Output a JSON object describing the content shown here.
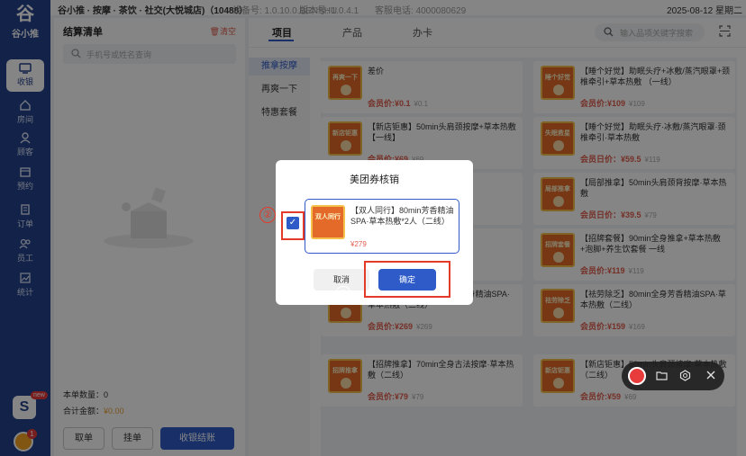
{
  "sidebar": {
    "logo_text": "谷小推",
    "items": [
      {
        "label": "收银",
        "icon": "cashier-icon",
        "active": true
      },
      {
        "label": "房间",
        "icon": "home-icon"
      },
      {
        "label": "顾客",
        "icon": "customer-icon"
      },
      {
        "label": "预约",
        "icon": "calendar-icon"
      },
      {
        "label": "订单",
        "icon": "order-icon"
      },
      {
        "label": "员工",
        "icon": "staff-icon"
      },
      {
        "label": "统计",
        "icon": "chart-icon"
      }
    ],
    "badge_new": "new",
    "badge_count": "1"
  },
  "topbar": {
    "store": "谷小推 · 按摩 · 茶饮 · 社交(大悦城店)（10488）",
    "device": "设备号: 1.0.10.0.BENSHU",
    "version": "版本号: 1.0.4.1",
    "phone": "客服电话: 4000080629",
    "date": "2025-08-12 星期二"
  },
  "left": {
    "title": "结算清单",
    "clear": "清空",
    "search_placeholder": "手机号或姓名查询",
    "count": "本单数量：0",
    "total_label": "合计金额：",
    "total_value": "¥0.00",
    "btn_cancel_order": "取单",
    "btn_hold": "挂单",
    "btn_checkout": "收银结账"
  },
  "right": {
    "tabs": [
      "项目",
      "产品",
      "办卡"
    ],
    "search_placeholder": "输入品项关键字搜索",
    "categories": [
      "推拿按摩",
      "再爽一下",
      "特惠套餐"
    ],
    "cards": [
      {
        "thumb": "再爽一下",
        "name": "差价",
        "price": "会员价:¥0.1",
        "orig": "¥0.1"
      },
      {
        "thumb": "睡个好觉",
        "name": "【睡个好觉】助眠头疗+冰敷/蒸汽眼罩+颈椎牵引+草本热敷 （一线）",
        "price": "会员价:¥109",
        "orig": "¥109"
      },
      {
        "thumb": "新店钜惠",
        "name": "【新店钜惠】50min头肩颈按摩+草本热敷【一线】",
        "price": "会员价:¥69",
        "orig": "¥69"
      },
      {
        "thumb": "失眠救星",
        "name": "【睡个好觉】助眠头疗·冰敷/蒸汽眼罩·颈椎牵引·草本热敷",
        "price": "会员日价：¥59.5",
        "orig": "¥119"
      },
      {
        "thumb": "双人同行",
        "name": "按摩·草本热",
        "price": "",
        "orig": ""
      },
      {
        "thumb": "局部推拿",
        "name": "【局部推拿】50min头肩颈背按摩·草本热敷",
        "price": "会员日价：¥39.5",
        "orig": "¥79"
      },
      {
        "thumb": "双人同行",
        "name": "蒸汽眼罩·颈",
        "price": "",
        "orig": ""
      },
      {
        "thumb": "招牌套餐",
        "name": "【招牌套餐】90min全身推拿+草本热敷+泡脚+养生饮套餐 一线",
        "price": "会员价:¥119",
        "orig": "¥119"
      },
      {
        "thumb": "舒缓放松",
        "name": "【舒缓放松】100min芳香全身精油SPA·草本热敷（二线）",
        "price": "会员价:¥269",
        "orig": "¥269"
      },
      {
        "thumb": "祛劳除乏",
        "name": "【祛劳除乏】80min全身芳香精油SPA·草本热敷（二线）",
        "price": "会员价:¥159",
        "orig": "¥169"
      },
      {
        "thumb": "招牌推拿",
        "name": "【招牌推拿】70min全身古法按摩·草本热敷（二线）",
        "price": "会员价:¥79",
        "orig": "¥79"
      },
      {
        "thumb": "新店钜惠",
        "name": "【新店钜惠】50min头肩颈按摩·草本热敷（二线）",
        "price": "会员价:¥59",
        "orig": "¥69"
      }
    ]
  },
  "dialog": {
    "title": "美团券核销",
    "item_thumb": "双人同行",
    "item_name": "【双人同行】80min芳香精油SPA·草本热敷*2人（二线）",
    "item_price": "¥279",
    "cancel": "取消",
    "ok": "确定",
    "anno1": "②",
    "anno3": "③",
    "checkmark": "✓"
  },
  "colors": {
    "brand": "#24418c",
    "accent": "#2e5bc8",
    "price": "#e05a4a",
    "annotation": "#e43a2a"
  }
}
